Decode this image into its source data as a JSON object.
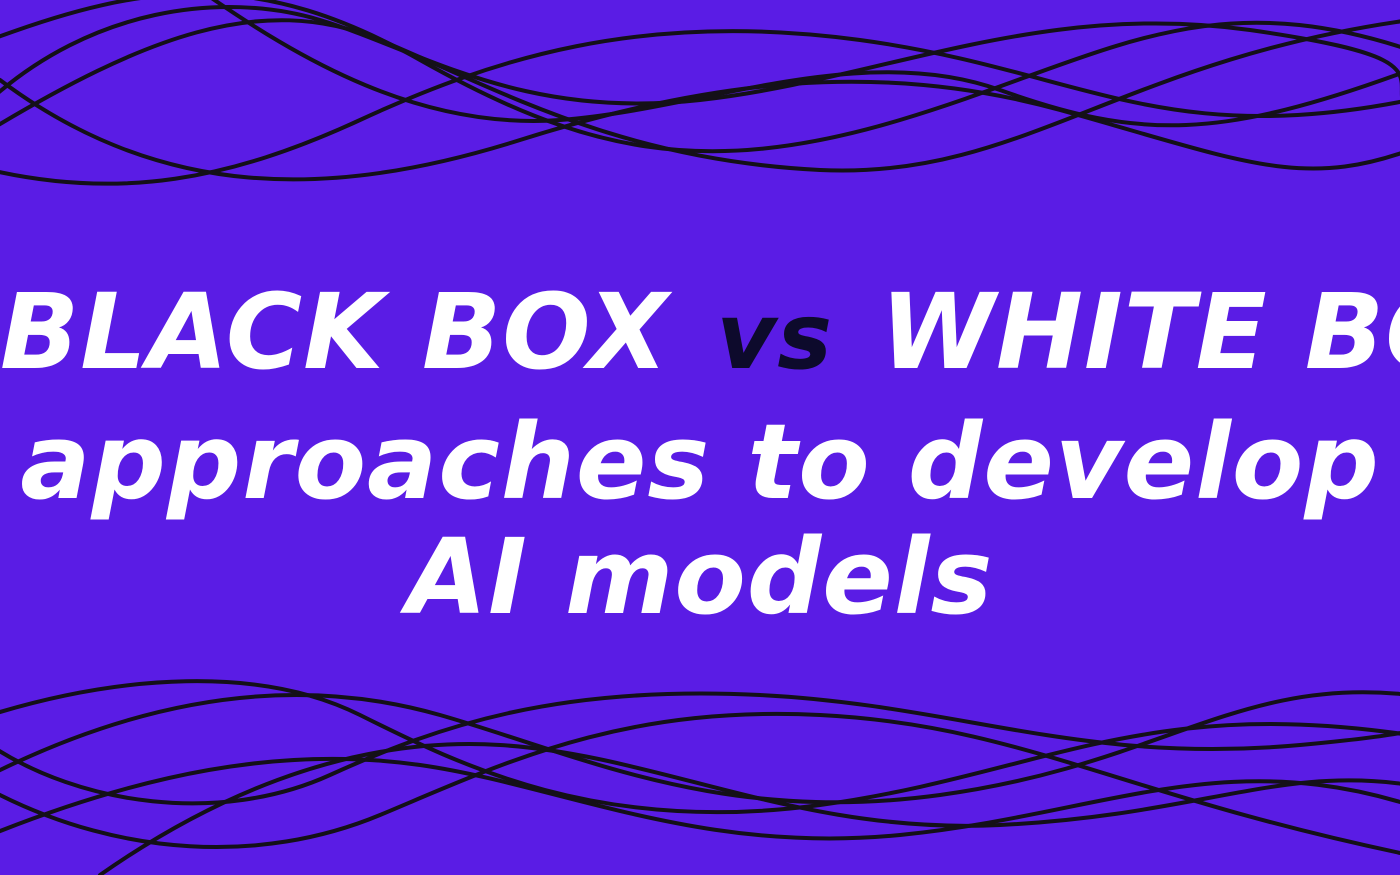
{
  "colors": {
    "background": "#5a1ce5",
    "text": "#ffffff",
    "vs": "#0d0a2c",
    "wave_lines": "#141018"
  },
  "headline": {
    "line1_left": "BLACK BOX",
    "line1_vs": "vs",
    "line1_right": "WHITE BOX",
    "line2": "approaches to develop",
    "line3": "AI models"
  }
}
